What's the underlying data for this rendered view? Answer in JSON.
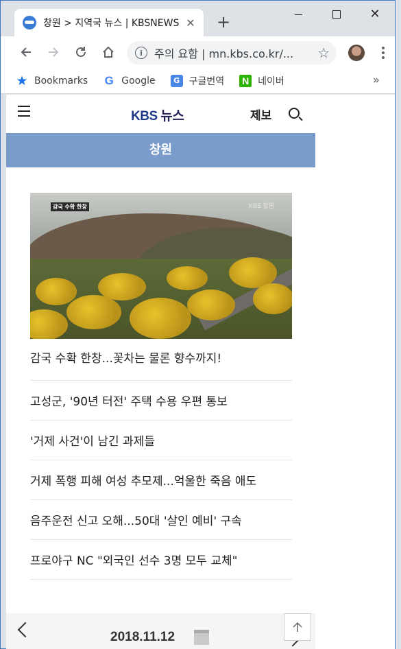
{
  "browser": {
    "tab_title": "창원 > 지역국 뉴스 | KBSNEWS",
    "new_tab": "+",
    "tab_close": "✕",
    "url_warning": "주의 요함",
    "url_sep": "|",
    "url": "mn.kbs.co.kr/...",
    "bookmarks": [
      {
        "label": "Bookmarks",
        "icon": "star-icon"
      },
      {
        "label": "Google",
        "icon": "google-icon"
      },
      {
        "label": "구글번역",
        "icon": "translate-icon"
      },
      {
        "label": "네이버",
        "icon": "naver-icon"
      }
    ],
    "bookmarks_more": "»"
  },
  "site": {
    "logo_kbs": "KBS",
    "logo_news": " 뉴스",
    "report_label": "제보",
    "region": "창원",
    "hero_caption": "감국 수확 한창",
    "hero_watermark": "KBS 창원",
    "headline": "감국 수확 한창...꽃차는 물론 향수까지!",
    "news": [
      "고성군, '90년 터전' 주택 수용 우편 통보",
      "'거제 사건'이 남긴 과제들",
      "거제 폭행 피해 여성 추모제...억울한 죽음 애도",
      "음주운전 신고 오해...50대 '살인 예비' 구속",
      "프로야구 NC \"외국인 선수 3명 모두 교체\""
    ],
    "date": "2018.11.12"
  },
  "colors": {
    "region_bar": "#7a9ccb",
    "logo": "#1e3a8a"
  }
}
